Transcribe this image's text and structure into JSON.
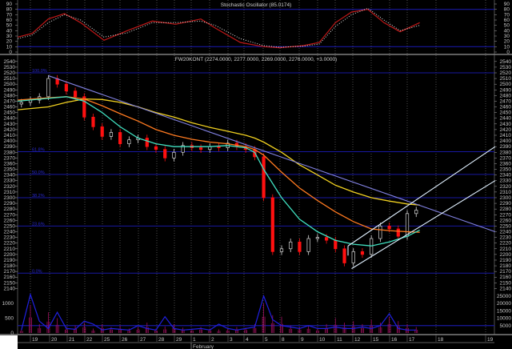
{
  "chart_data": {
    "type": "candlestick",
    "colors": {
      "up": "#d8d8d8",
      "down": "#ff1010",
      "ma_fast": "#40e0c0",
      "ma_mid": "#ff7a20",
      "ma_slow": "#f0d020",
      "trendline": "#8080e0",
      "channel": "#e0f0ff",
      "fib": "#1818a0",
      "stoch_main": "#c01818",
      "stoch_signal": "#e8e8e8",
      "volume_line": "#2020e0",
      "volume_bars": "#a01060"
    },
    "stochastic": {
      "title": "Stochastic Oscillator (85.0174)",
      "yticks": [
        "90",
        "80",
        "70",
        "60",
        "50",
        "40",
        "30",
        "20",
        "10",
        "0"
      ],
      "ylim": [
        0,
        90
      ],
      "levels": [
        80,
        10
      ],
      "x": [
        -0.7,
        0.1,
        1,
        1.9,
        2.8,
        4.1,
        5.4,
        6.8,
        8.1,
        9.5,
        10.3,
        11.7,
        13,
        13.9,
        15.2,
        16.1,
        17,
        17.9,
        18.8,
        19.7,
        20.6,
        21.7
      ],
      "main": [
        28,
        35,
        62,
        72,
        55,
        22,
        40,
        58,
        52,
        62,
        45,
        18,
        10,
        8,
        12,
        18,
        55,
        75,
        80,
        55,
        38,
        55
      ],
      "signal": [
        25,
        32,
        55,
        70,
        60,
        28,
        36,
        55,
        55,
        58,
        50,
        25,
        12,
        9,
        11,
        15,
        48,
        70,
        82,
        60,
        40,
        50
      ]
    },
    "price": {
      "title": "FW20KONT (2274.0000, 2277.0000, 2269.0000, 2276.0000, +3.0000)",
      "yticks": [
        "2540",
        "2530",
        "2520",
        "2510",
        "2500",
        "2490",
        "2480",
        "2470",
        "2460",
        "2450",
        "2440",
        "2430",
        "2420",
        "2410",
        "2400",
        "2390",
        "2380",
        "2370",
        "2360",
        "2350",
        "2340",
        "2330",
        "2320",
        "2310",
        "2300",
        "2290",
        "2280",
        "2270",
        "2260",
        "2250",
        "2240",
        "2230",
        "2220",
        "2210",
        "2200",
        "2190",
        "2180",
        "2170",
        "2160",
        "2150",
        "2140"
      ],
      "ylim": [
        2140,
        2540
      ],
      "x": [
        -0.5,
        0,
        0.5,
        1,
        1.5,
        2,
        2.5,
        3,
        3.5,
        4,
        4.5,
        5,
        5.5,
        6,
        6.5,
        7,
        7.5,
        8,
        8.5,
        9,
        9.5,
        10,
        10.5,
        11,
        11.5,
        12,
        12.5,
        13,
        13.5,
        14,
        14.5,
        15,
        15.5,
        16,
        16.5,
        17,
        17.5,
        18,
        18.5,
        19,
        19.5,
        20,
        20.5,
        21,
        21.5
      ],
      "close": [
        2468,
        2472,
        2478,
        2510,
        2500,
        2488,
        2478,
        2442,
        2425,
        2408,
        2415,
        2395,
        2402,
        2405,
        2390,
        2385,
        2370,
        2380,
        2392,
        2388,
        2385,
        2390,
        2388,
        2396,
        2390,
        2385,
        2372,
        2300,
        2205,
        2210,
        2222,
        2205,
        2228,
        2230,
        2225,
        2210,
        2185,
        2205,
        2200,
        2228,
        2250,
        2245,
        2232,
        2272,
        2278
      ],
      "ma_x": [
        -0.7,
        1,
        2,
        3,
        4,
        5,
        6,
        7,
        8,
        9,
        10,
        11,
        12,
        12.5,
        13,
        14,
        15,
        16,
        17,
        18,
        19,
        20,
        21,
        21.7
      ],
      "ma_fast": [
        2470,
        2475,
        2478,
        2470,
        2450,
        2425,
        2405,
        2395,
        2390,
        2390,
        2390,
        2392,
        2388,
        2380,
        2350,
        2300,
        2262,
        2240,
        2225,
        2218,
        2215,
        2222,
        2232,
        2243
      ],
      "ma_mid": [
        2472,
        2476,
        2478,
        2474,
        2462,
        2448,
        2435,
        2420,
        2410,
        2403,
        2398,
        2395,
        2390,
        2385,
        2375,
        2345,
        2317,
        2295,
        2275,
        2258,
        2245,
        2242,
        2240,
        2239
      ],
      "ma_slow": [
        2455,
        2460,
        2468,
        2474,
        2473,
        2468,
        2460,
        2450,
        2442,
        2432,
        2424,
        2417,
        2410,
        2405,
        2398,
        2380,
        2358,
        2340,
        2322,
        2310,
        2300,
        2294,
        2289,
        2287
      ],
      "trendlines": [
        {
          "from": [
            1,
            2515
          ],
          "to": [
            25.9,
            2240
          ]
        },
        {
          "from": [
            17.7,
            2215
          ],
          "to": [
            25.9,
            2390
          ]
        },
        {
          "from": [
            17.9,
            2175
          ],
          "to": [
            25.9,
            2330
          ]
        }
      ],
      "fib_levels": [
        {
          "label": "100.0%",
          "value": 2520
        },
        {
          "label": "61.8%",
          "value": 2381
        },
        {
          "label": "50.0%",
          "value": 2341
        },
        {
          "label": "38.2%",
          "value": 2300
        },
        {
          "label": "23.6%",
          "value": 2250
        },
        {
          "label": "0.0%",
          "value": 2167
        }
      ]
    },
    "volume": {
      "left_ticks": [
        "1000",
        "500",
        "0"
      ],
      "right_ticks": [
        "25000",
        "20000",
        "15000",
        "10000",
        "5000"
      ],
      "x": [
        -0.5,
        0,
        0.5,
        1,
        1.5,
        2,
        2.5,
        3,
        3.5,
        4,
        4.5,
        5,
        5.5,
        6,
        6.5,
        7,
        7.5,
        8,
        8.5,
        9,
        9.5,
        10,
        10.5,
        11,
        11.5,
        12,
        12.5,
        13,
        13.5,
        14,
        14.5,
        15,
        15.5,
        16,
        16.5,
        17,
        17.5,
        18,
        18.5,
        19,
        19.5,
        20,
        20.5,
        21,
        21.5
      ],
      "contracts": [
        120,
        950,
        300,
        700,
        500,
        200,
        250,
        350,
        150,
        300,
        200,
        250,
        150,
        200,
        350,
        150,
        220,
        300,
        180,
        150,
        200,
        150,
        120,
        150,
        200,
        180,
        300,
        1000,
        600,
        550,
        250,
        200,
        250,
        150,
        300,
        500,
        350,
        400,
        300,
        450,
        350,
        550,
        400,
        300,
        200
      ],
      "open_interest": [
        2000,
        26000,
        8000,
        3000,
        14000,
        3000,
        2500,
        8000,
        6000,
        2000,
        3000,
        2500,
        2000,
        5000,
        3000,
        2000,
        11000,
        3000,
        2000,
        2500,
        3000,
        2000,
        6000,
        3000,
        2000,
        3000,
        4000,
        25000,
        9000,
        5000,
        4000,
        3000,
        5000,
        3000,
        3000,
        4000,
        3000,
        3000,
        4000,
        3000,
        5000,
        13000,
        3000,
        2000,
        2000
      ]
    },
    "x_axis": {
      "labels": [
        "19",
        "20",
        "21",
        "22",
        "25",
        "26",
        "27",
        "28",
        "29",
        "1",
        "2",
        "3",
        "4",
        "5",
        "8",
        "9",
        "10",
        "11",
        "12",
        "15",
        "16",
        "17",
        "18",
        "19"
      ],
      "month_label": "February"
    }
  }
}
